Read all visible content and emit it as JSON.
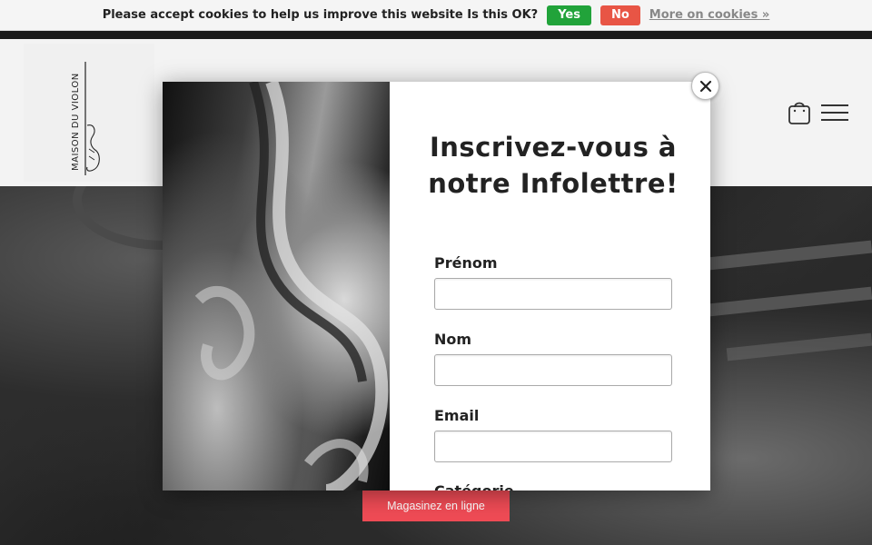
{
  "cookie_bar": {
    "message": "Please accept cookies to help us improve this website Is this OK?",
    "yes_label": "Yes",
    "no_label": "No",
    "more_label": "More on cookies »",
    "yes_color": "#21a33a",
    "no_color": "#e85545"
  },
  "header": {
    "logo_text": "MAISON DU VIOLON",
    "cart_icon": "shopping-bag-icon",
    "menu_icon": "hamburger-menu-icon"
  },
  "modal": {
    "title": "Inscrivez-vous à notre Infolettre!",
    "fields": [
      {
        "label": "Prénom",
        "value": ""
      },
      {
        "label": "Nom",
        "value": ""
      },
      {
        "label": "Email",
        "value": ""
      }
    ],
    "partial_label": "Catégorie",
    "close_icon": "close-icon"
  },
  "hero": {
    "shop_button_label": "Magasinez en ligne",
    "accent_color": "#ef4b55"
  }
}
